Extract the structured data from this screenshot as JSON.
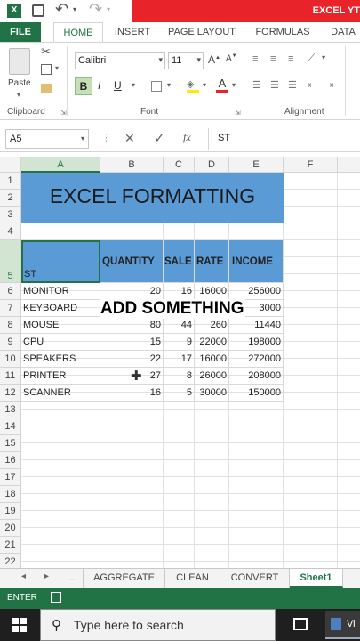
{
  "window": {
    "title": "EXCEL YT"
  },
  "quick_access": {
    "app_icon": "excel-icon",
    "undo": "↶",
    "redo": "↷"
  },
  "ribbon_tabs": [
    "FILE",
    "HOME",
    "INSERT",
    "PAGE LAYOUT",
    "FORMULAS",
    "DATA"
  ],
  "ribbon": {
    "paste_label": "Paste",
    "font_name": "Calibri",
    "font_size": "11",
    "groups": [
      "Clipboard",
      "Font",
      "Alignment"
    ]
  },
  "formula_bar": {
    "name_box": "A5",
    "fx": "fx",
    "value": "ST"
  },
  "columns": [
    "A",
    "B",
    "C",
    "D",
    "E",
    "F"
  ],
  "rows": [
    "1",
    "2",
    "3",
    "4",
    "5",
    "6",
    "7",
    "8",
    "9",
    "10",
    "11",
    "12",
    "13",
    "14",
    "15",
    "16",
    "17",
    "18",
    "19",
    "20",
    "21",
    "22"
  ],
  "sheet": {
    "title": "EXCEL FORMATTING",
    "header": {
      "a": "ST",
      "b": "QUANTITY",
      "c": "SALE",
      "d": "RATE",
      "e": "INCOME"
    },
    "data": [
      {
        "name": "MONITOR",
        "qty": "20",
        "sale": "16",
        "rate": "16000",
        "income": "256000"
      },
      {
        "name": "KEYBOARD",
        "qty": "",
        "sale": "",
        "rate": "",
        "income": "3000"
      },
      {
        "name": "MOUSE",
        "qty": "80",
        "sale": "44",
        "rate": "260",
        "income": "11440"
      },
      {
        "name": "CPU",
        "qty": "15",
        "sale": "9",
        "rate": "22000",
        "income": "198000"
      },
      {
        "name": "SPEAKERS",
        "qty": "22",
        "sale": "17",
        "rate": "16000",
        "income": "272000"
      },
      {
        "name": "PRINTER",
        "qty": "27",
        "sale": "8",
        "rate": "26000",
        "income": "208000"
      },
      {
        "name": "SCANNER",
        "qty": "16",
        "sale": "5",
        "rate": "30000",
        "income": "150000"
      }
    ],
    "overlay_text": "ADD SOMETHING"
  },
  "sheet_tabs": [
    "...",
    "AGGREGATE",
    "CLEAN",
    "CONVERT",
    "Sheet1"
  ],
  "status": {
    "mode": "ENTER"
  },
  "taskbar": {
    "search_placeholder": "Type here to search",
    "app_label": "Vi"
  },
  "colors": {
    "excel_green": "#217346",
    "title_red": "#e8232a",
    "header_blue": "#5b9bd5"
  }
}
